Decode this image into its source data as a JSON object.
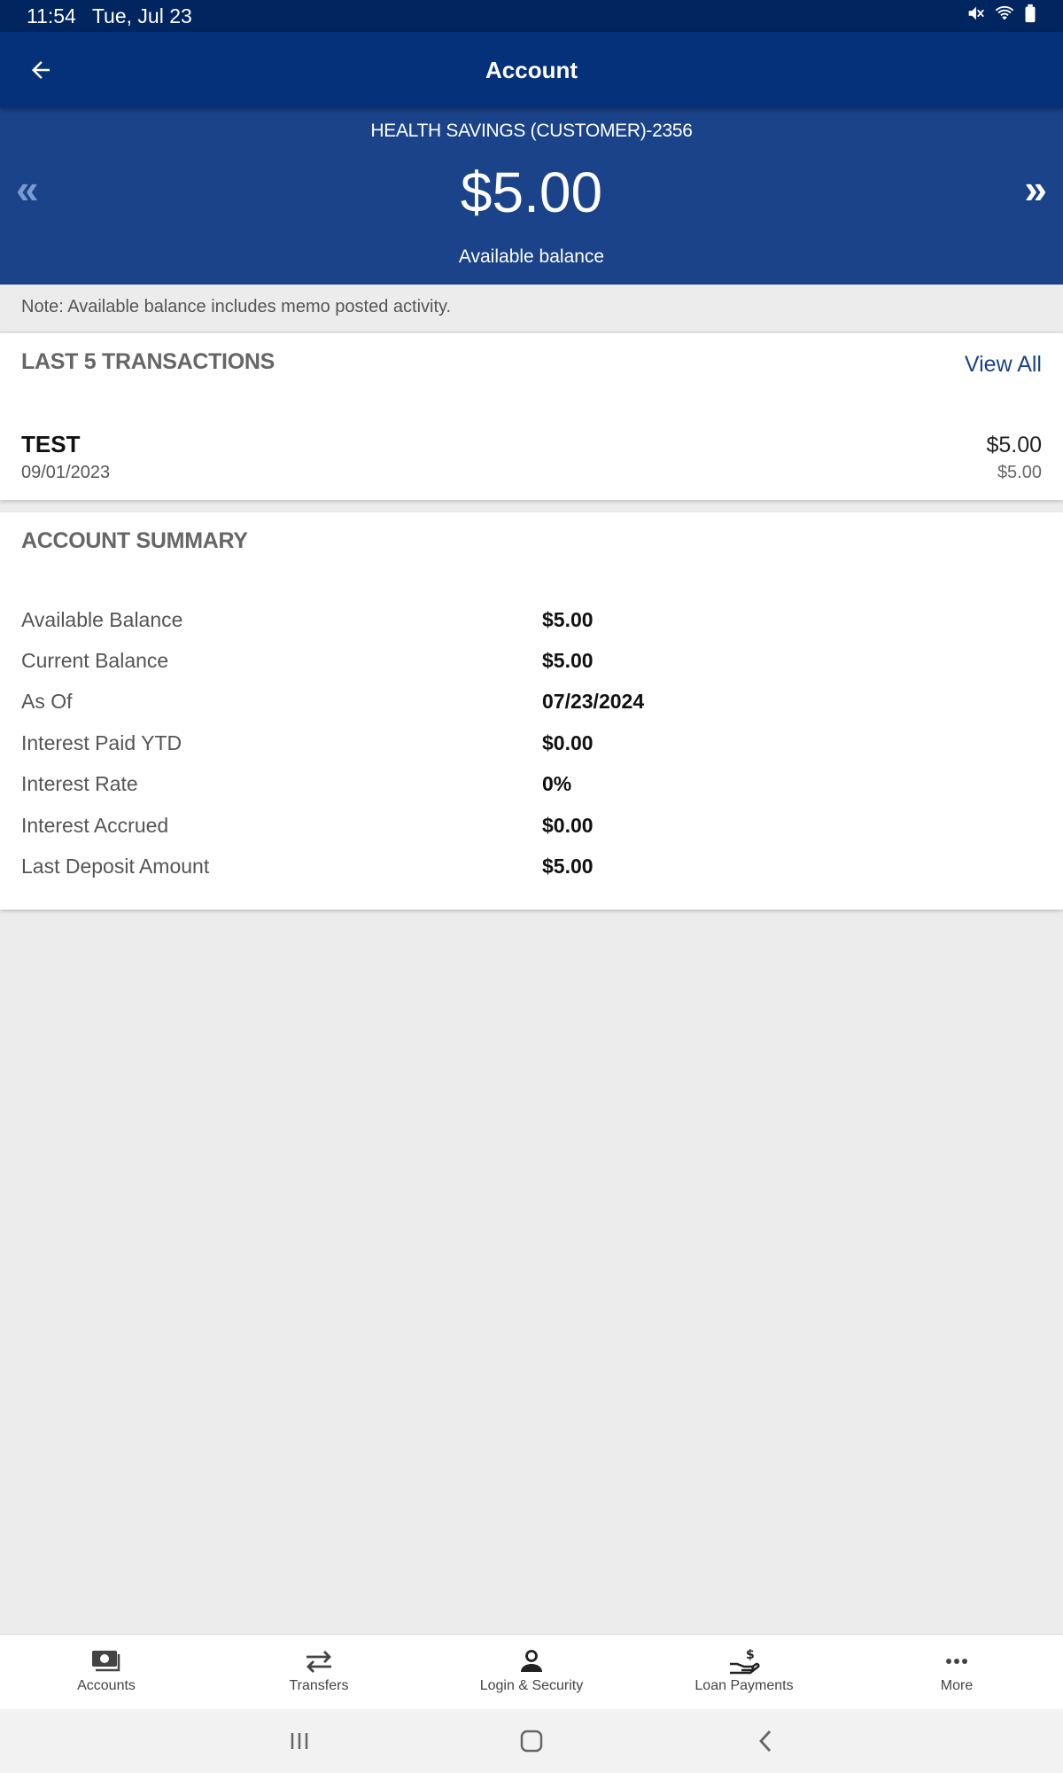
{
  "status_bar": {
    "time": "11:54",
    "date": "Tue, Jul 23"
  },
  "app_bar": {
    "title": "Account"
  },
  "account": {
    "name": "HEALTH SAVINGS (CUSTOMER)-2356",
    "balance": "$5.00",
    "balance_label": "Available balance",
    "prev_symbol": "«",
    "next_symbol": "»"
  },
  "note": "Note: Available balance includes memo posted activity.",
  "transactions": {
    "title": "LAST 5 TRANSACTIONS",
    "view_all": "View All",
    "items": [
      {
        "name": "TEST",
        "date": "09/01/2023",
        "amount": "$5.00",
        "balance": "$5.00"
      }
    ]
  },
  "summary": {
    "title": "ACCOUNT SUMMARY",
    "rows": [
      {
        "label": "Available Balance",
        "value": "$5.00"
      },
      {
        "label": "Current Balance",
        "value": "$5.00"
      },
      {
        "label": "As Of",
        "value": "07/23/2024"
      },
      {
        "label": "Interest Paid YTD",
        "value": "$0.00"
      },
      {
        "label": "Interest Rate",
        "value": "0%"
      },
      {
        "label": "Interest Accrued",
        "value": "$0.00"
      },
      {
        "label": "Last Deposit Amount",
        "value": "$5.00"
      }
    ]
  },
  "bottom_nav": [
    {
      "label": "Accounts",
      "icon": "accounts-icon"
    },
    {
      "label": "Transfers",
      "icon": "transfers-icon"
    },
    {
      "label": "Login & Security",
      "icon": "user-icon"
    },
    {
      "label": "Loan Payments",
      "icon": "loan-payment-icon"
    },
    {
      "label": "More",
      "icon": "more-icon"
    }
  ],
  "colors": {
    "status_bar": "#01255f",
    "app_bar": "#05317a",
    "balance_header": "#1b438a",
    "link": "#1b438a",
    "background": "#ececec"
  }
}
